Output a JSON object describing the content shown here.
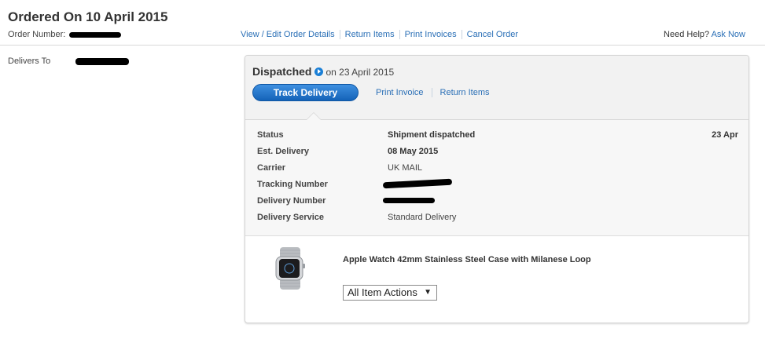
{
  "header": {
    "title": "Ordered On 10 April 2015",
    "order_number_label": "Order Number:",
    "links": [
      "View / Edit Order Details",
      "Return Items",
      "Print Invoices",
      "Cancel Order"
    ],
    "help_text": "Need Help?",
    "help_link": "Ask Now"
  },
  "delivers_to": {
    "label": "Delivers To"
  },
  "shipment": {
    "status_word": "Dispatched",
    "status_date": "on 23 April 2015",
    "track_button": "Track Delivery",
    "links": [
      "Print Invoice",
      "Return Items"
    ],
    "details": [
      {
        "label": "Status",
        "value": "Shipment dispatched",
        "right": "23 Apr"
      },
      {
        "label": "Est. Delivery",
        "value": "08 May 2015"
      },
      {
        "label": "Carrier",
        "value": "UK MAIL"
      },
      {
        "label": "Tracking Number",
        "value": ""
      },
      {
        "label": "Delivery Number",
        "value": ""
      },
      {
        "label": "Delivery Service",
        "value": "Standard Delivery"
      }
    ]
  },
  "item": {
    "title": "Apple Watch 42mm Stainless Steel Case with Milanese Loop",
    "actions_label": "All Item Actions",
    "image_icon": "apple-watch-product-image"
  },
  "colors": {
    "link": "#2a6fb6",
    "primary_button": "#1a6fc8"
  }
}
